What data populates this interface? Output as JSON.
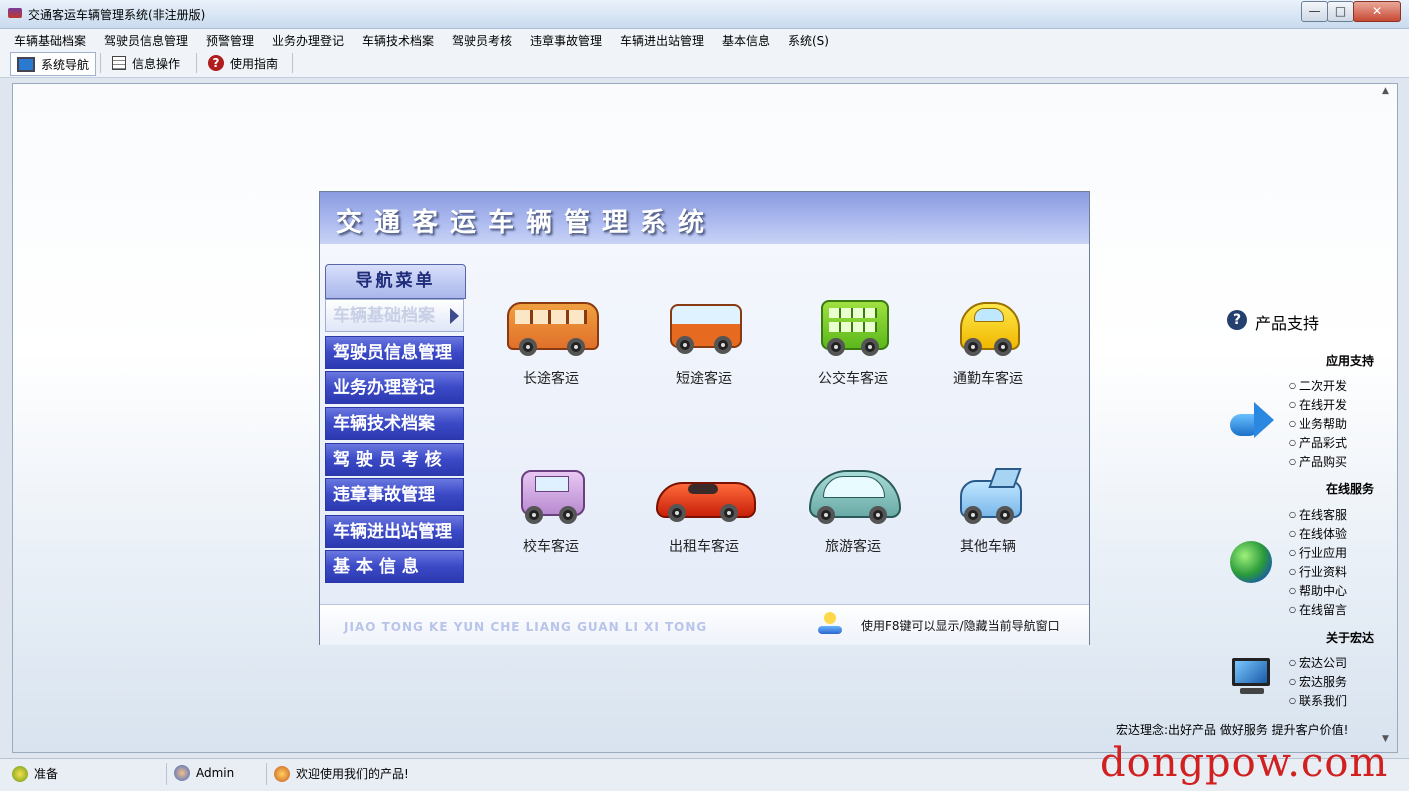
{
  "window": {
    "title": "交通客运车辆管理系统(非注册版)",
    "minimize": "—",
    "maximize": "□",
    "close": "✕"
  },
  "menubar": [
    "车辆基础档案",
    "驾驶员信息管理",
    "预警管理",
    "业务办理登记",
    "车辆技术档案",
    "驾驶员考核",
    "违章事故管理",
    "车辆进出站管理",
    "基本信息",
    "系统(S)"
  ],
  "toolbar": {
    "nav": "系统导航",
    "info": "信息操作",
    "guide": "使用指南"
  },
  "nav_window": {
    "title": "交通客运车辆管理系统",
    "menu_header": "导航菜单",
    "menu_items": [
      "车辆基础档案",
      "驾驶员信息管理",
      "业务办理登记",
      "车辆技术档案",
      "驾 驶 员 考 核",
      "违章事故管理",
      "车辆进出站管理",
      "基 本 信 息"
    ],
    "selected_index": 0,
    "vehicles": [
      "长途客运",
      "短途客运",
      "公交车客运",
      "通勤车客运",
      "校车客运",
      "出租车客运",
      "旅游客运",
      "其他车辆"
    ],
    "footer_pinyin": "JIAO TONG KE YUN CHE LIANG GUAN LI XI TONG",
    "footer_hint": "使用F8键可以显示/隐藏当前导航窗口"
  },
  "support": {
    "title": "产品支持",
    "sections": [
      {
        "heading": "应用支持",
        "links": [
          "二次开发",
          "在线开发",
          "业务帮助",
          "产品彩式",
          "产品购买"
        ]
      },
      {
        "heading": "在线服务",
        "links": [
          "在线客服",
          "在线体验",
          "行业应用",
          "行业资料",
          "帮助中心",
          "在线留言"
        ]
      },
      {
        "heading": "关于宏达",
        "links": [
          "宏达公司",
          "宏达服务",
          "联系我们"
        ]
      }
    ],
    "motto": "宏达理念:出好产品 做好服务 提升客户价值!"
  },
  "statusbar": {
    "ready": "准备",
    "user": "Admin",
    "welcome": "欢迎使用我们的产品!"
  },
  "watermark": "dongpow.com",
  "colors": {
    "nav_button": "#3b49c7",
    "header": "#aebcf0",
    "watermark": "#d12020"
  }
}
